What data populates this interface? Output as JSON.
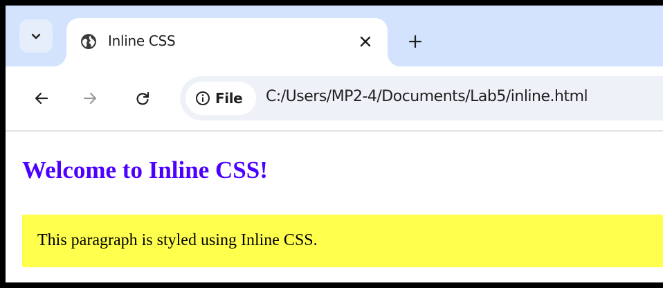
{
  "browser": {
    "tab": {
      "title": "Inline CSS",
      "favicon": "globe-icon"
    },
    "toolbar": {
      "site_info_chip": "File",
      "url": "C:/Users/MP2-4/Documents/Lab5/inline.html"
    }
  },
  "page": {
    "heading": "Welcome to Inline CSS!",
    "paragraph": "This paragraph is styled using Inline CSS."
  },
  "colors": {
    "tabstrip": "#d3e3fd",
    "heading": "#4c00ff",
    "paragraph_background": "#ffff4d"
  }
}
